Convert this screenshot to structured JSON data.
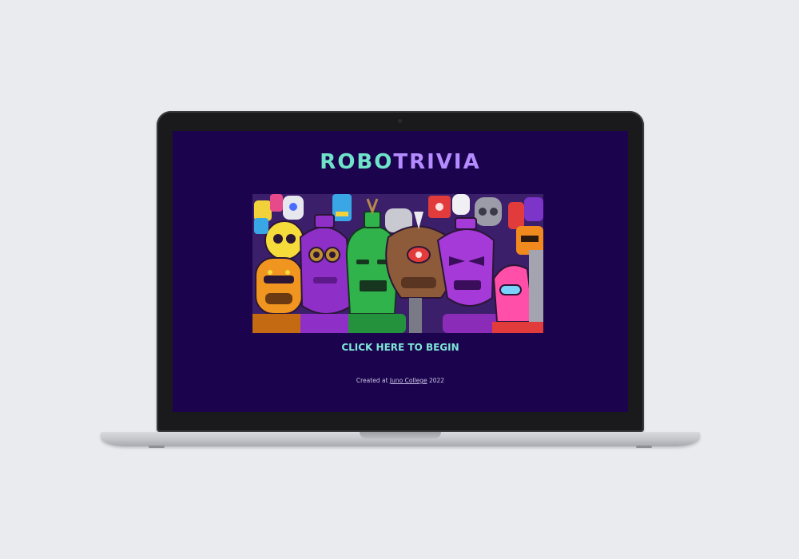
{
  "app": {
    "title_part1": "ROBO",
    "title_part2": "TRIVIA",
    "cta_label": "CLICK HERE TO BEGIN",
    "footer_prefix": "Created at ",
    "footer_link": "Juno College",
    "footer_suffix": " 2022"
  },
  "colors": {
    "screen_background": "#1b044d",
    "title_primary": "#6fe3c9",
    "title_secondary": "#b58cff",
    "cta": "#7ee8d8"
  },
  "hero_image": {
    "icon": "robot-crowd-illustration"
  }
}
